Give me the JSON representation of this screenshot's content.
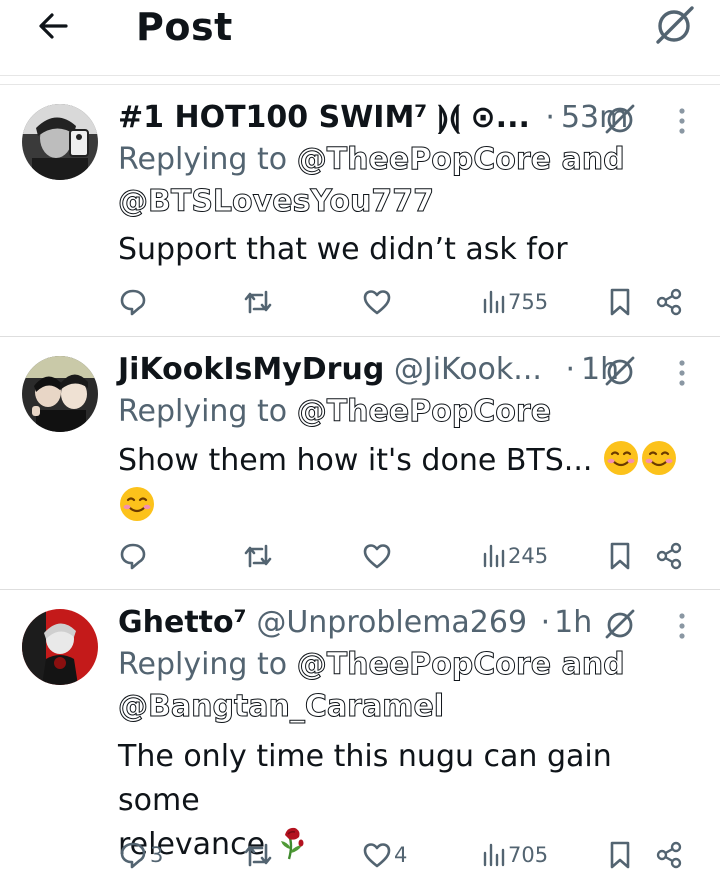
{
  "header": {
    "title": "Post"
  },
  "tweets": [
    {
      "display_name": "#1 HOT100 SWIM⁷ ⟭⟬ ⊙...",
      "handle": "",
      "separator": "·",
      "time": "53m",
      "replying_prefix": "Replying to",
      "mentions_line1": "@TheePopCore and",
      "mentions_line2": "@BTSLovesYou777",
      "text": "Support that we didn’t ask for",
      "text2": "",
      "stats": {
        "replies": "",
        "reposts": "",
        "likes": "",
        "views": "755"
      }
    },
    {
      "display_name": "JiKookIsMyDrug",
      "handle": "@JiKook...",
      "separator": "·",
      "time": "1h",
      "replying_prefix": "Replying to",
      "mentions_line1": "@TheePopCore",
      "mentions_line2": "",
      "text": "Show them how it's done BTS...",
      "text2": "",
      "stats": {
        "replies": "",
        "reposts": "",
        "likes": "",
        "views": "245"
      }
    },
    {
      "display_name": "Ghetto⁷",
      "handle": "@Unproblema269",
      "separator": "·",
      "time": "1h",
      "replying_prefix": "Replying to",
      "mentions_line1": "@TheePopCore and",
      "mentions_line2": "@Bangtan_Caramel",
      "text": "The only time this nugu can gain some",
      "text2": "relevance",
      "stats": {
        "replies": "3",
        "reposts": "",
        "likes": "4",
        "views": "705"
      }
    }
  ],
  "icons": {
    "back": "arrow-left-icon",
    "grok": "grok-icon",
    "more": "more-vertical-icon",
    "reply": "reply-icon",
    "repost": "repost-icon",
    "like": "heart-icon",
    "views": "views-icon",
    "bookmark": "bookmark-icon",
    "share": "share-icon"
  },
  "colors": {
    "text": "#0f1419",
    "muted": "#536471",
    "divider": "#e6e6e6"
  }
}
